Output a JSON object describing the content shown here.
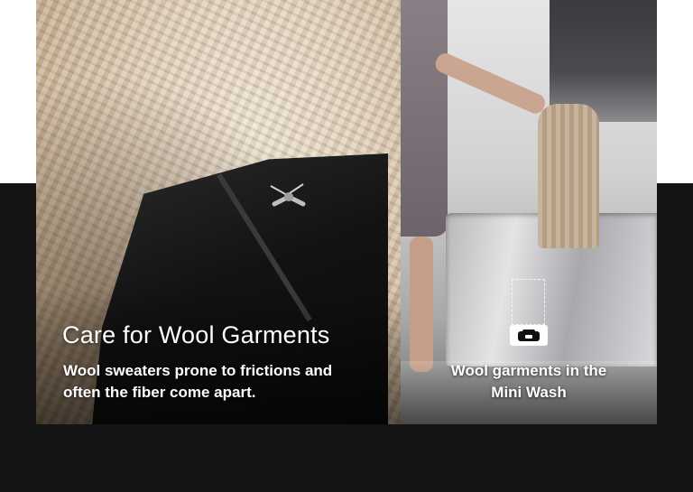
{
  "feature": {
    "title": "Care for Wool Garments",
    "description_line1": "Wool sweaters prone to frictions and",
    "description_line2": "often the fiber come apart."
  },
  "product": {
    "caption_line1": "Wool garments in the",
    "caption_line2": "Mini Wash",
    "icon": "washer-icon"
  },
  "colors": {
    "background_dark": "#141414",
    "background_light": "#ffffff",
    "text": "#ffffff"
  }
}
